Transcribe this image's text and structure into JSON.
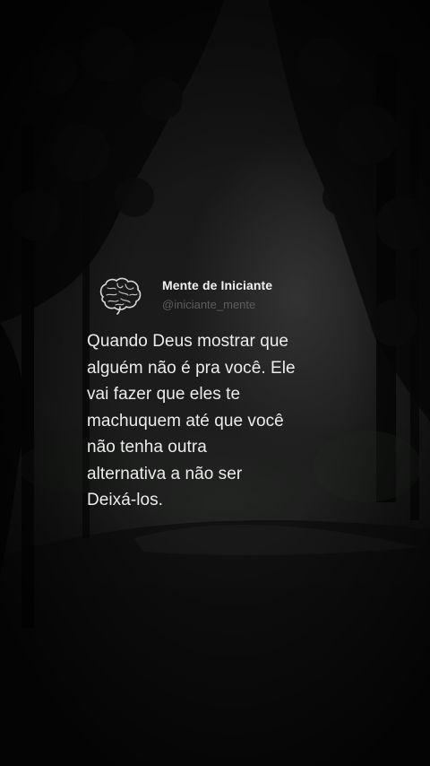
{
  "post": {
    "author": {
      "display_name": "Mente de Iniciante",
      "handle": "@iniciante_mente",
      "avatar_icon": "brain-icon"
    },
    "text": "Quando Deus mostrar que\nalguém não é pra você. Ele\nvai fazer que eles te\nmachuquem até que você\nnão tenha outra\nalternativa a não ser\nDeixá-los."
  },
  "colors": {
    "text": "#ececec",
    "name": "#f2f2f2",
    "handle": "#5d5d5d",
    "background": "#141414"
  }
}
